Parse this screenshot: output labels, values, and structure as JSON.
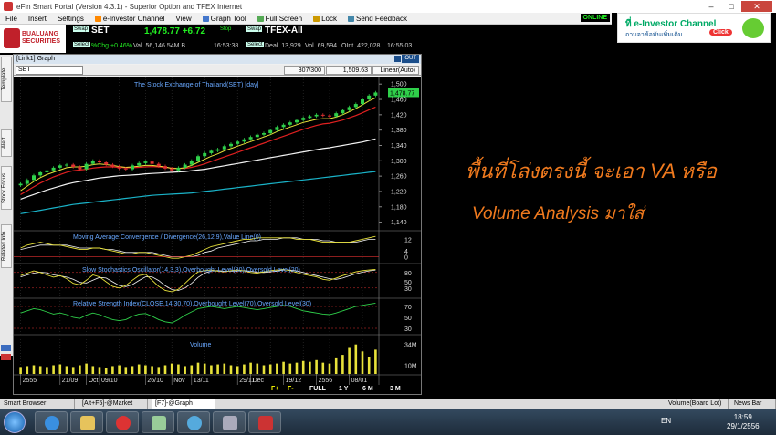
{
  "titlebar": {
    "title": "eFin Smart Portal (Version 4.3.1) - Superior Option and TFEX Internet",
    "min": "–",
    "max": "□",
    "close": "✕"
  },
  "menu": {
    "items": [
      "File",
      "Insert",
      "Settings",
      "e-Investor Channel",
      "View",
      "Graph Tool",
      "Full Screen",
      "Lock",
      "Send Feedback"
    ],
    "online": "ONLINE"
  },
  "banner": {
    "title": "e-Investor Channel",
    "subtitle": "ถามจาข้อมันเพิ่มเติม",
    "click": "Click",
    "prefix": "ที่"
  },
  "logo": {
    "line1": "BUALUANG",
    "line2": "SECURITIES"
  },
  "quote_set": {
    "swap": "Swap",
    "select": "Select",
    "symbol": "SET",
    "last": "1,478.77 +6.72",
    "stop": "Stop",
    "chg": "%Chg.+0.46%",
    "vol": "Val. 56,146.54M B.",
    "time": "16:53:38"
  },
  "quote_tfex": {
    "swap": "Swap",
    "select": "Select",
    "symbol": "TFEX-All",
    "deal": "Deal. 13,929",
    "vol": "Vol. 69,594",
    "oint": "OInt. 422,028",
    "time": "16:55:03"
  },
  "chartwin": {
    "title": "[Link1] Graph",
    "out": "OUT",
    "symbol": "SET",
    "count": "307/300",
    "value": "1,509.63",
    "scale": "Linear(Auto)",
    "main_label": "The Stock Exchange of Thailand(SET) [day]",
    "macd_label": "Moving Average Convergence / Divergence(26,12,9),Value Line(0)",
    "sto_label": "Slow Stochastics Oscillator(14,3,3),Overbought Level(80),Oversold Level(20)",
    "rsi_label": "Relative Strength Index(CLOSE,14,30,70),Overbought Level(70),Oversold Level(30)",
    "vol_label": "Volume",
    "price_tag": "1,478.77",
    "y_ticks": [
      "1,500",
      "1,460",
      "1,420",
      "1,380",
      "1,340",
      "1,300",
      "1,260",
      "1,220",
      "1,180",
      "1,140"
    ],
    "macd_ticks": [
      "12",
      "4",
      "0"
    ],
    "sto_ticks": [
      "80",
      "50",
      "30"
    ],
    "rsi_ticks": [
      "70",
      "50",
      "30"
    ],
    "vol_ticks": [
      "34M",
      "10M"
    ],
    "x_ticks": [
      "2555",
      "21/09",
      "Oct",
      "09/10",
      "26/10",
      "Nov",
      "13/11",
      "29/11",
      "Dec",
      "19/12",
      "2556",
      "08/01"
    ],
    "bottom_buttons": [
      "FULL",
      "1 Y",
      "6 M",
      "3 M"
    ]
  },
  "side_tabs": [
    "Template",
    "Alert",
    "Stock Focus",
    "Related Info"
  ],
  "note": {
    "line1": "พื้นที่โล่งตรงนี้ จะเอา VA หรือ",
    "line2": "Volume Analysis มาใส่"
  },
  "statusbar": {
    "left": "Smart Browser",
    "tab1": "[Alt+F5]-@Market",
    "tab2": "[F7]-@Graph",
    "right1": "Volume(Board Lot)",
    "right2": "News Bar"
  },
  "taskbar": {
    "lang": "EN",
    "time": "18:59",
    "date": "29/1/2556"
  },
  "chart_data": {
    "type": "candlestick",
    "title": "The Stock Exchange of Thailand(SET) [day]",
    "ylim": [
      1120,
      1510
    ],
    "close": [
      1240,
      1250,
      1262,
      1270,
      1275,
      1282,
      1288,
      1290,
      1284,
      1278,
      1292,
      1300,
      1296,
      1290,
      1285,
      1280,
      1278,
      1288,
      1294,
      1298,
      1292,
      1286,
      1280,
      1275,
      1282,
      1290,
      1300,
      1312,
      1320,
      1326,
      1330,
      1338,
      1344,
      1350,
      1356,
      1362,
      1368,
      1372,
      1380,
      1388,
      1394,
      1400,
      1406,
      1412,
      1416,
      1420,
      1418,
      1416,
      1424,
      1432,
      1440,
      1448,
      1460,
      1470,
      1478
    ],
    "ma_yellow": [
      1222,
      1234,
      1246,
      1256,
      1264,
      1270,
      1276,
      1282,
      1284,
      1284,
      1286,
      1290,
      1292,
      1290,
      1288,
      1285,
      1283,
      1284,
      1286,
      1288,
      1288,
      1286,
      1284,
      1280,
      1280,
      1282,
      1288,
      1296,
      1304,
      1312,
      1318,
      1326,
      1332,
      1338,
      1344,
      1350,
      1356,
      1362,
      1368,
      1376,
      1382,
      1388,
      1394,
      1400,
      1404,
      1408,
      1410,
      1410,
      1414,
      1420,
      1428,
      1436,
      1446,
      1456,
      1464
    ],
    "ma_red": [
      1212,
      1222,
      1232,
      1242,
      1250,
      1258,
      1264,
      1270,
      1274,
      1276,
      1278,
      1281,
      1283,
      1284,
      1284,
      1283,
      1282,
      1282,
      1283,
      1284,
      1285,
      1284,
      1283,
      1281,
      1280,
      1280,
      1283,
      1287,
      1292,
      1298,
      1304,
      1310,
      1316,
      1322,
      1328,
      1334,
      1340,
      1346,
      1352,
      1358,
      1364,
      1370,
      1376,
      1382,
      1387,
      1392,
      1396,
      1398,
      1402,
      1406,
      1412,
      1418,
      1425,
      1433,
      1440
    ],
    "ma_white": [
      1200,
      1206,
      1212,
      1218,
      1224,
      1229,
      1234,
      1239,
      1243,
      1246,
      1249,
      1252,
      1255,
      1257,
      1259,
      1261,
      1262,
      1263,
      1264,
      1266,
      1267,
      1268,
      1269,
      1270,
      1271,
      1272,
      1274,
      1276,
      1278,
      1281,
      1284,
      1287,
      1290,
      1293,
      1296,
      1299,
      1302,
      1305,
      1308,
      1311,
      1314,
      1317,
      1320,
      1323,
      1326,
      1329,
      1332,
      1334,
      1337,
      1340,
      1343,
      1346,
      1349,
      1353,
      1357
    ],
    "ma_cyan": [
      1162,
      1165,
      1168,
      1171,
      1174,
      1177,
      1180,
      1183,
      1186,
      1188,
      1190,
      1192,
      1194,
      1196,
      1198,
      1200,
      1202,
      1204,
      1206,
      1208,
      1210,
      1211,
      1212,
      1213,
      1214,
      1215,
      1216,
      1218,
      1220,
      1222,
      1224,
      1226,
      1228,
      1230,
      1232,
      1234,
      1236,
      1238,
      1240,
      1242,
      1244,
      1246,
      1248,
      1250,
      1252,
      1254,
      1256,
      1258,
      1260,
      1262,
      1264,
      1266,
      1268,
      1270,
      1272
    ],
    "macd_ylim": [
      -4,
      16
    ],
    "macd": [
      6,
      8,
      9,
      10,
      9,
      8,
      8,
      7,
      6,
      5,
      5,
      6,
      6,
      5,
      4,
      3,
      2,
      2,
      3,
      3,
      2,
      1,
      0,
      -1,
      -1,
      0,
      1,
      3,
      5,
      7,
      8,
      9,
      10,
      11,
      12,
      12,
      13,
      13,
      13,
      13,
      13,
      13,
      12,
      12,
      12,
      11,
      10,
      10,
      10,
      10,
      10,
      11,
      12,
      13,
      14
    ],
    "macd_signal": [
      5,
      6,
      7,
      8,
      8,
      8,
      8,
      8,
      7,
      6,
      6,
      6,
      6,
      5,
      5,
      4,
      3,
      3,
      3,
      3,
      3,
      2,
      1,
      0,
      0,
      0,
      0,
      1,
      3,
      4,
      6,
      7,
      8,
      9,
      10,
      11,
      11,
      12,
      12,
      12,
      13,
      13,
      13,
      12,
      12,
      12,
      11,
      11,
      10,
      10,
      10,
      10,
      11,
      12,
      12
    ],
    "sto_ylim": [
      0,
      100
    ],
    "sto_k": [
      70,
      78,
      85,
      80,
      72,
      65,
      70,
      60,
      45,
      40,
      55,
      72,
      66,
      50,
      35,
      30,
      38,
      55,
      70,
      74,
      55,
      35,
      22,
      18,
      26,
      45,
      65,
      82,
      86,
      88,
      84,
      82,
      86,
      88,
      85,
      80,
      78,
      82,
      86,
      88,
      90,
      86,
      80,
      74,
      70,
      66,
      58,
      55,
      62,
      70,
      76,
      82,
      86,
      88,
      90
    ],
    "sto_d": [
      66,
      72,
      78,
      81,
      79,
      72,
      69,
      65,
      58,
      48,
      46,
      55,
      64,
      62,
      50,
      38,
      34,
      41,
      54,
      66,
      66,
      54,
      37,
      25,
      22,
      30,
      45,
      64,
      78,
      85,
      86,
      84,
      84,
      85,
      86,
      84,
      81,
      80,
      82,
      85,
      88,
      88,
      85,
      80,
      75,
      70,
      65,
      60,
      58,
      62,
      69,
      76,
      81,
      85,
      88
    ],
    "rsi_ylim": [
      20,
      80
    ],
    "rsi": [
      58,
      62,
      66,
      64,
      60,
      56,
      58,
      55,
      50,
      48,
      54,
      58,
      55,
      50,
      46,
      44,
      46,
      52,
      56,
      57,
      52,
      46,
      42,
      40,
      46,
      54,
      60,
      66,
      68,
      70,
      68,
      66,
      68,
      70,
      68,
      66,
      64,
      66,
      68,
      70,
      72,
      70,
      66,
      62,
      60,
      58,
      56,
      55,
      58,
      62,
      66,
      70,
      72,
      74,
      76
    ],
    "volume_ylim": [
      0,
      40
    ],
    "volume": [
      8,
      9,
      10,
      9,
      8,
      10,
      11,
      9,
      8,
      10,
      12,
      9,
      8,
      7,
      9,
      10,
      8,
      9,
      11,
      10,
      9,
      8,
      10,
      12,
      11,
      9,
      10,
      13,
      12,
      10,
      11,
      12,
      10,
      9,
      11,
      13,
      12,
      10,
      11,
      12,
      14,
      12,
      13,
      15,
      14,
      16,
      13,
      12,
      18,
      22,
      30,
      34,
      26,
      20,
      28
    ]
  }
}
